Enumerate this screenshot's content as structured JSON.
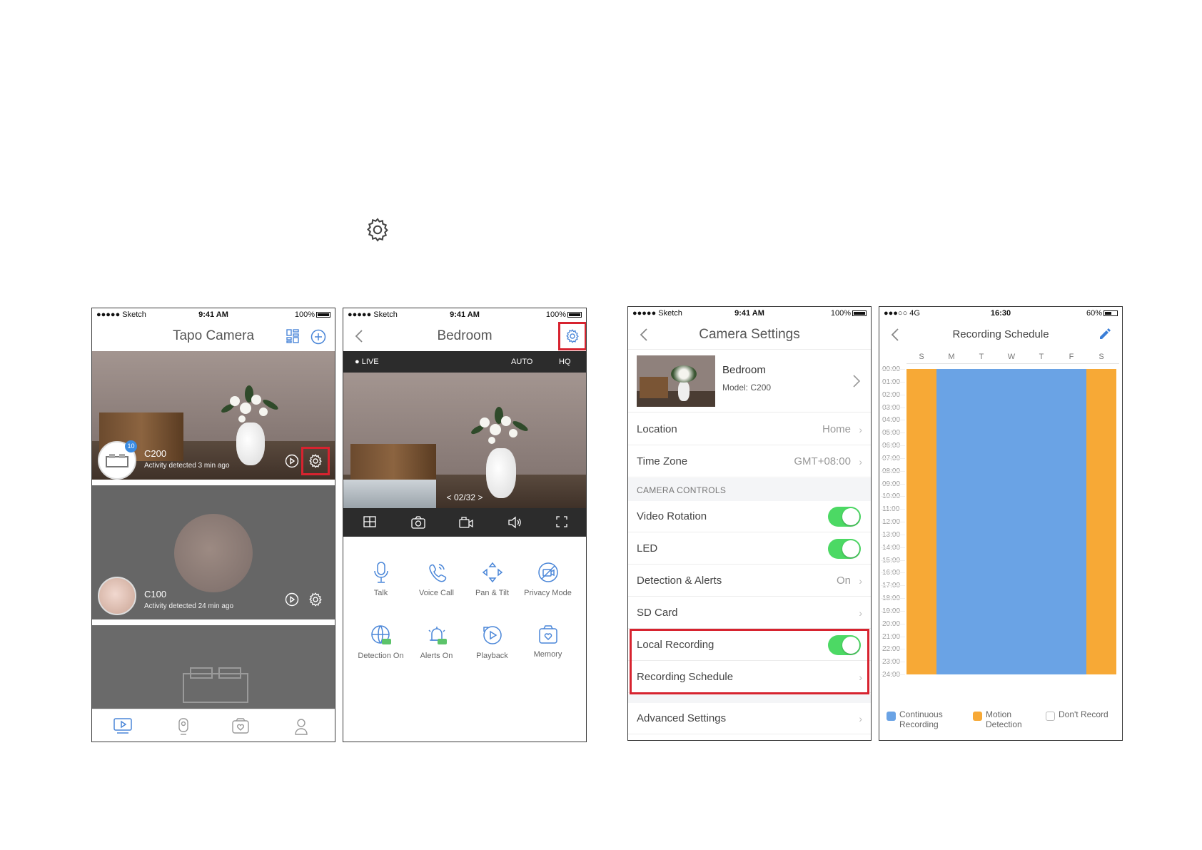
{
  "colors": {
    "highlight": "#d7232f",
    "toggle_on": "#4cd964",
    "continuous": "#6aa3e5",
    "motion": "#f7a936",
    "accent_blue": "#3b8be0"
  },
  "status": {
    "carrier": "●●●●● Sketch",
    "time": "9:41 AM",
    "battery": "100%",
    "carrier_4g": "●●●○○ 4G",
    "time_4g": "16:30",
    "battery_4g": "60%"
  },
  "home": {
    "title": "Tapo Camera",
    "cameras": [
      {
        "name": "C200",
        "activity": "Activity detected 3 min ago",
        "badge": "10"
      },
      {
        "name": "C100",
        "activity": "Activity detected 24 min ago"
      }
    ],
    "tabs": [
      "video-tab-icon",
      "camera-tab-icon",
      "memory-tab-icon",
      "profile-tab-icon"
    ]
  },
  "live": {
    "title": "Bedroom",
    "live_label": "● LIVE",
    "auto_label": "AUTO",
    "hq_label": "HQ",
    "page_counter": "<  02/32  >",
    "actions": [
      {
        "label": "Talk",
        "icon": "microphone-icon"
      },
      {
        "label": "Voice Call",
        "icon": "phone-icon"
      },
      {
        "label": "Pan & Tilt",
        "icon": "pan-tilt-icon"
      },
      {
        "label": "Privacy Mode",
        "icon": "privacy-icon"
      },
      {
        "label": "Detection On",
        "icon": "detection-icon"
      },
      {
        "label": "Alerts On",
        "icon": "alerts-icon"
      },
      {
        "label": "Playback",
        "icon": "playback-icon"
      },
      {
        "label": "Memory",
        "icon": "memory-icon"
      }
    ]
  },
  "settings": {
    "title": "Camera Settings",
    "device_name": "Bedroom",
    "device_model": "Model: C200",
    "location_label": "Location",
    "location_value": "Home",
    "timezone_label": "Time Zone",
    "timezone_value": "GMT+08:00",
    "section_controls": "CAMERA CONTROLS",
    "video_rotation": "Video Rotation",
    "led": "LED",
    "detection_label": "Detection & Alerts",
    "detection_value": "On",
    "sd_card": "SD Card",
    "local_recording": "Local Recording",
    "recording_schedule": "Recording Schedule",
    "advanced": "Advanced Settings"
  },
  "schedule": {
    "title": "Recording Schedule",
    "days": [
      "S",
      "M",
      "T",
      "W",
      "T",
      "F",
      "S"
    ],
    "hours": [
      "00:00",
      "01:00",
      "02:00",
      "03:00",
      "04:00",
      "05:00",
      "06:00",
      "07:00",
      "08:00",
      "09:00",
      "10:00",
      "11:00",
      "12:00",
      "13:00",
      "14:00",
      "15:00",
      "16:00",
      "17:00",
      "18:00",
      "19:00",
      "20:00",
      "21:00",
      "22:00",
      "23:00",
      "24:00"
    ],
    "day_modes": [
      "motion",
      "continuous",
      "continuous",
      "continuous",
      "continuous",
      "continuous",
      "motion"
    ],
    "legend": {
      "continuous": "Continuous Recording",
      "motion": "Motion Detection",
      "none": "Don't Record"
    }
  }
}
